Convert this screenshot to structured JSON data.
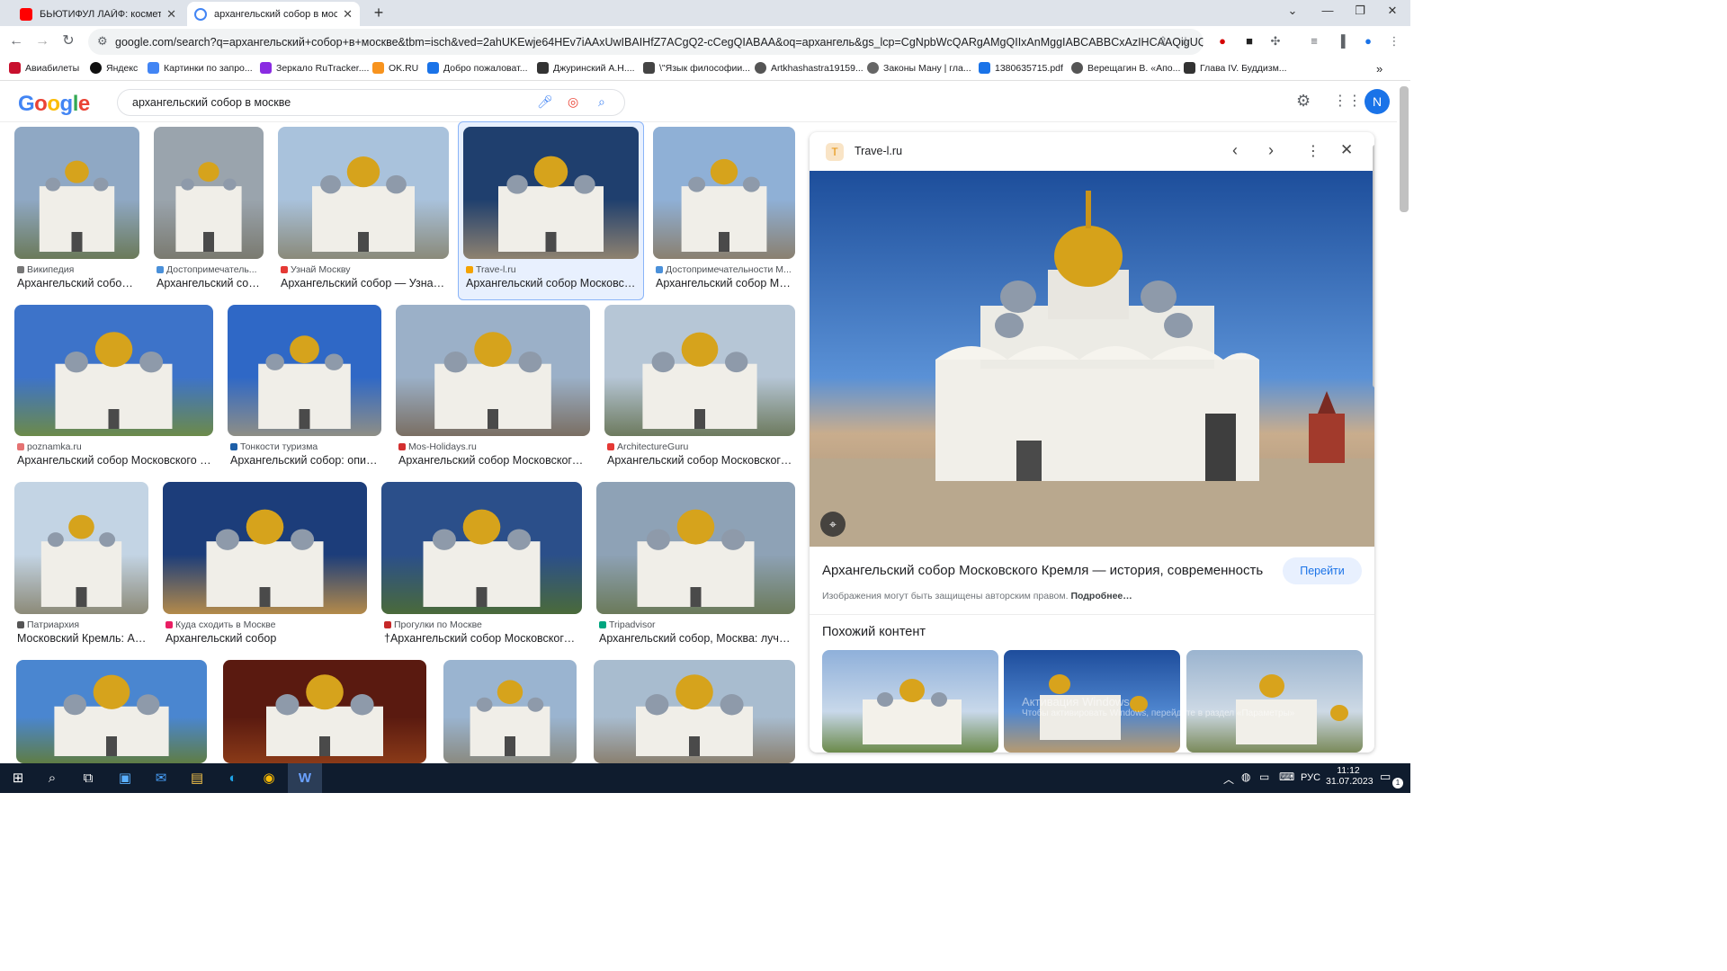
{
  "browser": {
    "tabs": [
      {
        "title": "БЬЮТИФУЛ ЛАЙФ: косметоло",
        "favicon_color": "#ff0000",
        "close": "✕"
      },
      {
        "title": "архангельский собор в моске",
        "favicon_color": "#4285f4",
        "close": "✕"
      }
    ],
    "new_tab": "+",
    "url": "google.com/search?q=архангельский+собор+в+москве&tbm=isch&ved=2ahUKEwje64HEv7iAAxUwIBAIHfZ7ACgQ2-cCegQIABAA&oq=архангель&gs_lcp=CgNpbWcQARgAMgQIIxAnMggIABCABBCxAzIHCAAQigUQQzIICAA..."
  },
  "bookmarks": [
    {
      "label": "Авиабилеты",
      "color": "#c8102e"
    },
    {
      "label": "Яндекс",
      "color": "#111111"
    },
    {
      "label": "Картинки по запро...",
      "color": "#4285f4"
    },
    {
      "label": "Зеркало RuTracker....",
      "color": "#8a2be2"
    },
    {
      "label": "OK.RU",
      "color": "#f7931e"
    },
    {
      "label": "Добро пожаловат...",
      "color": "#1a73e8"
    },
    {
      "label": "Джуринский А.Н....",
      "color": "#333333"
    },
    {
      "label": "\\\"Язык философии...",
      "color": "#444444"
    },
    {
      "label": "Artkhashastra19159...",
      "color": "#555555"
    },
    {
      "label": "Законы Ману | гла...",
      "color": "#666666"
    },
    {
      "label": "1380635715.pdf",
      "color": "#1a73e8"
    },
    {
      "label": "Верещагин В. «Апо...",
      "color": "#555555"
    },
    {
      "label": "Глава IV. Буддизм...",
      "color": "#333333"
    }
  ],
  "google": {
    "query": "архангельский собор в москве",
    "avatar": "N"
  },
  "results": [
    {
      "source": "Википедия",
      "caption": "Архангельский собор ...",
      "icolor": "#777777",
      "sky": "#8fa8c4",
      "ground": "#6b7a5a"
    },
    {
      "source": "Достопримечатель...",
      "caption": "Архангельский соб...",
      "icolor": "#4a90d9",
      "sky": "#9aa4ad",
      "ground": "#7a7a70"
    },
    {
      "source": "Узнай Москву",
      "caption": "Архангельский собор — Узнай ...",
      "icolor": "#e53935",
      "sky": "#a9c2dc",
      "ground": "#8a8a7a"
    },
    {
      "source": "Trave-l.ru",
      "caption": "Архангельский собор Московск...",
      "icolor": "#f4a300",
      "sky": "#1f3f6e",
      "ground": "#8e8270"
    },
    {
      "source": "Достопримечательности М...",
      "caption": "Архангельский собор Мо...",
      "icolor": "#4a90d9",
      "sky": "#8fb0d6",
      "ground": "#8a8070"
    },
    {
      "source": "poznamka.ru",
      "caption": "Архангельский собор Московского к...",
      "icolor": "#e57373",
      "sky": "#3d73c9",
      "ground": "#6c8a4a"
    },
    {
      "source": "Тонкости туризма",
      "caption": "Архангельский собор: опис...",
      "icolor": "#1e5fa8",
      "sky": "#2f68c6",
      "ground": "#8e8e86"
    },
    {
      "source": "Mos-Holidays.ru",
      "caption": "Архангельский собор Московского ...",
      "icolor": "#d32f2f",
      "sky": "#9bb0c8",
      "ground": "#7a6f63"
    },
    {
      "source": "ArchitectureGuru",
      "caption": "Архангельский собор Московского ...",
      "icolor": "#e53935",
      "sky": "#b6c6d6",
      "ground": "#6d7a5e"
    },
    {
      "source": "Патриархия",
      "caption": "Московский Кремль: Ар...",
      "icolor": "#555555",
      "sky": "#c3d4e4",
      "ground": "#8c8a78"
    },
    {
      "source": "Куда сходить в Москве",
      "caption": "Архангельский собор",
      "icolor": "#e91e63",
      "sky": "#1c3d7a",
      "ground": "#b48a4a"
    },
    {
      "source": "Прогулки по Москве",
      "caption": "†Архангельский собор Московского ...",
      "icolor": "#c62828",
      "sky": "#2b4f8a",
      "ground": "#4a6a3a"
    },
    {
      "source": "Tripadvisor",
      "caption": "Архангельский собор, Москва: лучш...",
      "icolor": "#00a680",
      "sky": "#8ea2b6",
      "ground": "#6b7a5a"
    },
    {
      "source": "",
      "caption": "",
      "icolor": "#ffffff",
      "sky": "#4a86d0",
      "ground": "#5f7d45"
    },
    {
      "source": "",
      "caption": "",
      "icolor": "#ffffff",
      "sky": "#5a1a10",
      "ground": "#8a3a18"
    },
    {
      "source": "",
      "caption": "",
      "icolor": "#ffffff",
      "sky": "#9ab4d0",
      "ground": "#8a8a80"
    },
    {
      "source": "",
      "caption": "",
      "icolor": "#ffffff",
      "sky": "#a8bccf",
      "ground": "#8a8070"
    }
  ],
  "panel": {
    "site": "Trave-l.ru",
    "title": "Архангельский собор Московского Кремля — история, современность",
    "visit_label": "Перейти",
    "copyright": "Изображения могут быть защищены авторским правом.",
    "more": "Подробнее…",
    "related_heading": "Похожий контент",
    "activation_line1": "Активация Windows",
    "activation_line2": "Чтобы активировать Windows, перейдите в раздел «Параметры»"
  },
  "taskbar": {
    "lang": "РУС",
    "time": "11:12",
    "date": "31.07.2023",
    "notifications": "1"
  }
}
